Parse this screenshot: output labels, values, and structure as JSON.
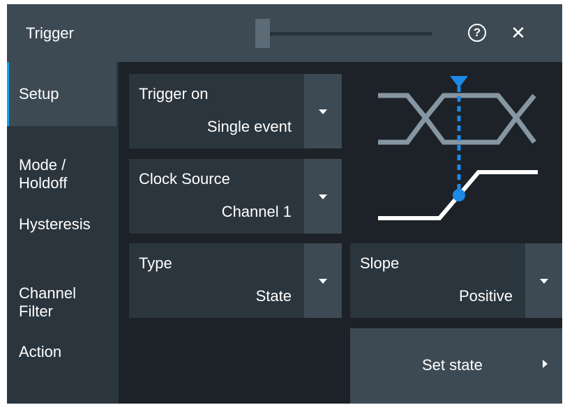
{
  "window": {
    "title": "Trigger",
    "help_glyph": "?",
    "close_glyph": "✕"
  },
  "sidebar": {
    "items": [
      {
        "label": "Setup",
        "active": true
      },
      {
        "label": "Mode /\nHoldoff",
        "active": false
      },
      {
        "label": "Hysteresis",
        "active": false
      },
      {
        "label": "Channel\nFilter",
        "active": false
      },
      {
        "label": "Action",
        "active": false
      }
    ]
  },
  "fields": {
    "trigger_on": {
      "label": "Trigger on",
      "value": "Single event"
    },
    "clock_source": {
      "label": "Clock Source",
      "value": "Channel 1"
    },
    "type": {
      "label": "Type",
      "value": "State"
    },
    "slope": {
      "label": "Slope",
      "value": "Positive"
    }
  },
  "actions": {
    "set_state": "Set state"
  },
  "icons": {
    "help": "help-circle-icon",
    "close": "close-icon",
    "dropdown": "caret-down-icon",
    "submenu": "caret-right-icon"
  },
  "colors": {
    "background": "#1c2227",
    "panel": "#2b353d",
    "button": "#3d4a54",
    "accent": "#0ea5e9",
    "marker": "#1e88e5",
    "waveform_gray": "#8696a3"
  }
}
